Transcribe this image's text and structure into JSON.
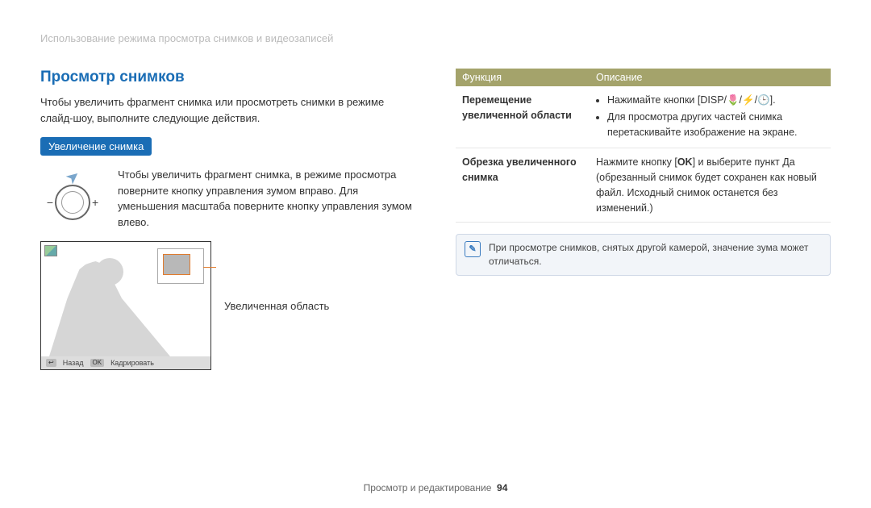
{
  "section_path": "Использование режима просмотра снимков и видеозаписей",
  "heading": "Просмотр снимков",
  "intro": "Чтобы увеличить фрагмент снимка или просмотреть снимки в режиме слайд-шоу, выполните следующие действия.",
  "subheading": "Увеличение снимка",
  "zoom_instruction": "Чтобы увеличить фрагмент снимка, в режиме просмотра поверните кнопку управления зумом вправо. Для уменьшения масштаба поверните кнопку управления зумом влево.",
  "minus": "−",
  "plus": "+",
  "preview": {
    "back_key": "↩",
    "back_label": "Назад",
    "ok_key": "OK",
    "ok_label": "Кадрировать"
  },
  "callout_label": "Увеличенная область",
  "table": {
    "header_function": "Функция",
    "header_description": "Описание",
    "rows": [
      {
        "function": "Перемещение увеличенной области",
        "bullets": [
          "Нажимайте кнопки [DISP/🌷/⚡/🕒].",
          "Для просмотра других частей снимка перетаскивайте изображение на экране."
        ]
      },
      {
        "function": "Обрезка увеличенного снимка",
        "text_pre": "Нажмите кнопку [",
        "text_key": "OK",
        "text_post": "] и выберите пункт Да (обрезанный снимок будет сохранен как новый файл. Исходный снимок останется без изменений.)"
      }
    ]
  },
  "note": "При просмотре снимков, снятых другой камерой, значение зума может отличаться.",
  "footer_section": "Просмотр и редактирование",
  "page_number": "94"
}
